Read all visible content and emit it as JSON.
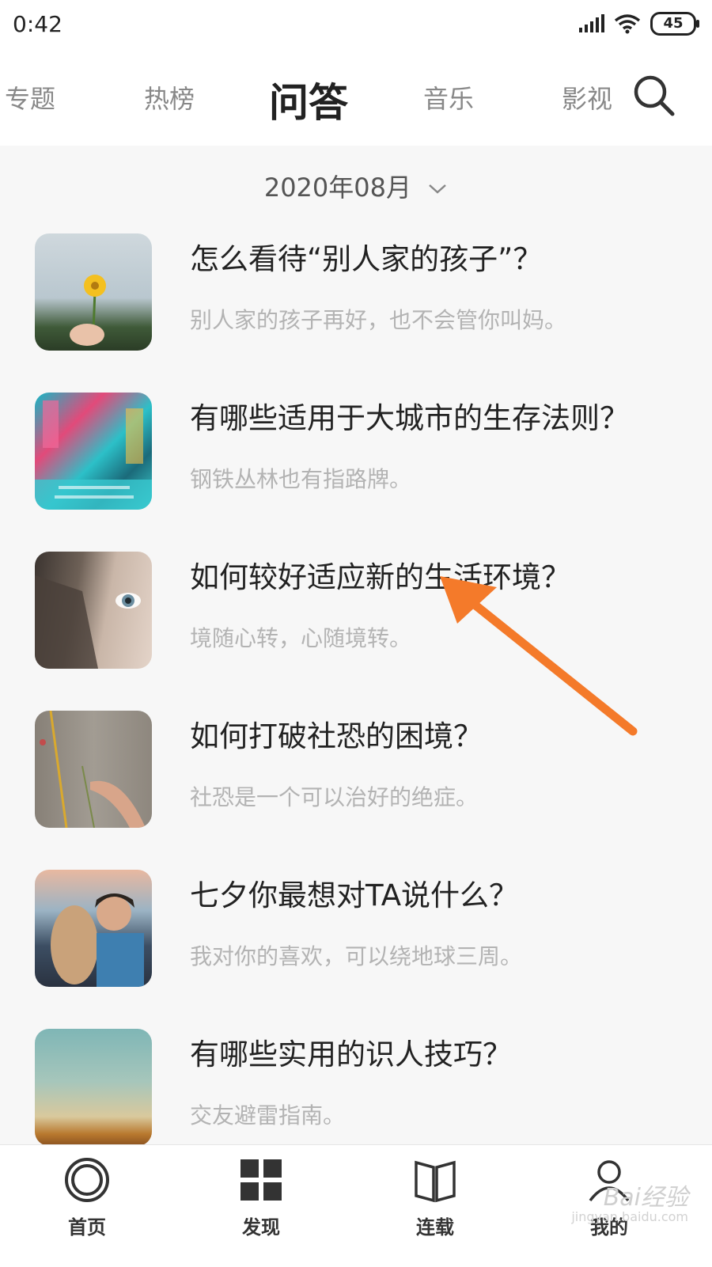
{
  "status_bar": {
    "time": "0:42",
    "battery": "45",
    "icons": [
      "signal-icon",
      "wifi-icon",
      "battery-icon"
    ]
  },
  "top_nav": {
    "tabs": [
      {
        "label": "专题",
        "active": false
      },
      {
        "label": "热榜",
        "active": false
      },
      {
        "label": "问答",
        "active": true
      },
      {
        "label": "音乐",
        "active": false
      },
      {
        "label": "影视",
        "active": false
      }
    ],
    "search_icon": "search-icon"
  },
  "date_filter": {
    "label": "2020年08月",
    "icon": "chevron-down-icon"
  },
  "questions": [
    {
      "title": "怎么看待“别人家的孩子”？",
      "subtitle": "别人家的孩子再好，也不会管你叫妈。"
    },
    {
      "title": "有哪些适用于大城市的生存法则？",
      "subtitle": "钢铁丛林也有指路牌。"
    },
    {
      "title": "如何较好适应新的生活环境？",
      "subtitle": "境随心转，心随境转。"
    },
    {
      "title": "如何打破社恐的困境？",
      "subtitle": "社恐是一个可以治好的绝症。"
    },
    {
      "title": "七夕你最想对TA说什么？",
      "subtitle": "我对你的喜欢，可以绕地球三周。"
    },
    {
      "title": "有哪些实用的识人技巧？",
      "subtitle": "交友避雷指南。"
    }
  ],
  "annotation": {
    "color": "#f47a2a"
  },
  "bottom_nav": {
    "items": [
      {
        "label": "首页",
        "icon": "home-circle-icon"
      },
      {
        "label": "发现",
        "icon": "grid-icon"
      },
      {
        "label": "连载",
        "icon": "book-icon"
      },
      {
        "label": "我的",
        "icon": "user-icon"
      }
    ]
  },
  "watermark": {
    "text": "Bai经验",
    "sub": "jingyan.baidu.com"
  }
}
